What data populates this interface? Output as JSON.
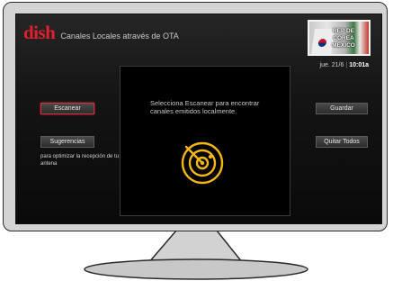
{
  "brand": {
    "logo": "dish",
    "title": "Canales Locales através de OTA"
  },
  "channel_preview": {
    "caption_line1": "REP DE COREA",
    "caption_line2": "MÉXICO"
  },
  "clock": {
    "date": "jue. 21/6",
    "time": "10:01a"
  },
  "panel": {
    "instructions": "Selecciona Escanear para encontrar canales emitidos localmente.",
    "icon": "radar-icon"
  },
  "left_buttons": {
    "scan": "Escanear",
    "suggestions": "Sugerencias",
    "help": "para optimizar la recepción de tu antena"
  },
  "right_buttons": {
    "save": "Guardar",
    "remove_all": "Quitar Todos"
  },
  "colors": {
    "accent": "#d32f3f",
    "radar": "#f2b713",
    "logo": "#e0202c"
  }
}
